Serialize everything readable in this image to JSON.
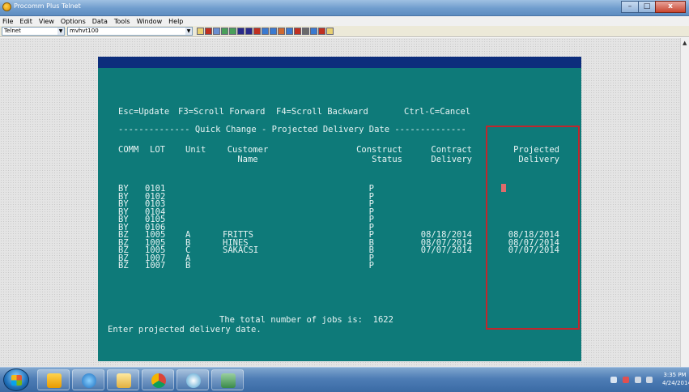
{
  "window": {
    "title": "Procomm Plus Telnet",
    "controls": [
      "–",
      "□",
      "x"
    ]
  },
  "menu": [
    "File",
    "Edit",
    "View",
    "Options",
    "Data",
    "Tools",
    "Window",
    "Help"
  ],
  "toolbar": {
    "connection_type": "Telnet",
    "host": "mvhvt100"
  },
  "terminal": {
    "function_keys": {
      "update": "Esc=Update",
      "scroll_forward": "F3=Scroll Forward",
      "scroll_backward": "F4=Scroll Backward",
      "cancel": "Ctrl-C=Cancel"
    },
    "screen_title": "-------------- Quick Change - Projected Delivery Date --------------",
    "columns": {
      "comm": "COMM",
      "lot": "LOT",
      "unit": "Unit",
      "customer_1": "Customer",
      "customer_2": "Name",
      "construct_1": "Construct",
      "construct_2": "Status",
      "contract_1": "Contract",
      "contract_2": "Delivery",
      "projected_1": "Projected",
      "projected_2": "Delivery"
    },
    "rows": [
      {
        "comm": "BY",
        "lot": "0101",
        "unit": "",
        "customer": "",
        "status": "P",
        "contract": "",
        "projected": ""
      },
      {
        "comm": "BY",
        "lot": "0102",
        "unit": "",
        "customer": "",
        "status": "P",
        "contract": "",
        "projected": ""
      },
      {
        "comm": "BY",
        "lot": "0103",
        "unit": "",
        "customer": "",
        "status": "P",
        "contract": "",
        "projected": ""
      },
      {
        "comm": "BY",
        "lot": "0104",
        "unit": "",
        "customer": "",
        "status": "P",
        "contract": "",
        "projected": ""
      },
      {
        "comm": "BY",
        "lot": "0105",
        "unit": "",
        "customer": "",
        "status": "P",
        "contract": "",
        "projected": ""
      },
      {
        "comm": "BY",
        "lot": "0106",
        "unit": "",
        "customer": "",
        "status": "P",
        "contract": "",
        "projected": ""
      },
      {
        "comm": "BZ",
        "lot": "1005",
        "unit": "A",
        "customer": "FRITTS",
        "status": "P",
        "contract": "08/18/2014",
        "projected": "08/18/2014"
      },
      {
        "comm": "BZ",
        "lot": "1005",
        "unit": "B",
        "customer": "HINES",
        "status": "B",
        "contract": "08/07/2014",
        "projected": "08/07/2014"
      },
      {
        "comm": "BZ",
        "lot": "1005",
        "unit": "C",
        "customer": "SAKACSI",
        "status": "B",
        "contract": "07/07/2014",
        "projected": "07/07/2014"
      },
      {
        "comm": "BZ",
        "lot": "1007",
        "unit": "A",
        "customer": "",
        "status": "P",
        "contract": "",
        "projected": ""
      },
      {
        "comm": "BZ",
        "lot": "1007",
        "unit": "B",
        "customer": "",
        "status": "P",
        "contract": "",
        "projected": ""
      }
    ],
    "total_jobs_text": "The total number of jobs is:  1622",
    "prompt": "Enter projected delivery date."
  },
  "taskbar": {
    "clock_time": "3:35 PM",
    "clock_date": "4/24/2014"
  },
  "colors": {
    "terminal_bg": "#0e7a79",
    "terminal_header": "#0c2d7c",
    "highlight_box": "#c0262d",
    "cursor": "#e06b6b"
  }
}
